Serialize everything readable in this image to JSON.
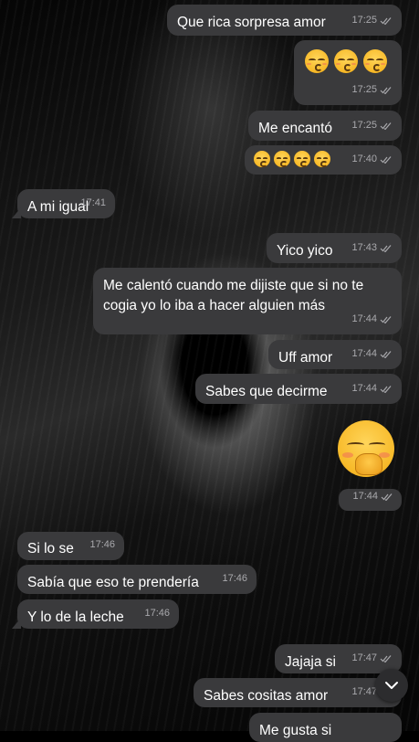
{
  "messages": [
    {
      "text": "Que rica sorpresa amor",
      "time": "17:25"
    },
    {
      "text": "",
      "time": "17:25"
    },
    {
      "text": "Me encantó",
      "time": "17:25"
    },
    {
      "text": "",
      "time": "17:40"
    },
    {
      "text": "A mi igual",
      "time": "17:41"
    },
    {
      "text": "Yico yico",
      "time": "17:43"
    },
    {
      "text": "Me calentó cuando me dijiste que si no te cogia yo lo iba a hacer alguien más",
      "time": "17:44"
    },
    {
      "text": "Uff amor",
      "time": "17:44"
    },
    {
      "text": "Sabes que decirme",
      "time": "17:44"
    },
    {
      "text": "",
      "time": "17:44"
    },
    {
      "text": "Si lo se",
      "time": "17:46"
    },
    {
      "text": "Sabía que eso te prendería",
      "time": "17:46"
    },
    {
      "text": "Y lo de la leche",
      "time": "17:46"
    },
    {
      "text": "Jajaja si",
      "time": "17:47"
    },
    {
      "text": "Sabes cositas amor",
      "time": "17:47"
    },
    {
      "text": "Me gusta si",
      "time": ""
    }
  ],
  "icons": {
    "read_receipt": "double-check-icon",
    "scroll_down": "chevron-down-icon",
    "emoji_kissing": "kissing-face-icon",
    "emoji_smirk": "smirking-face-icon",
    "emoji_hand_over_mouth": "hand-over-mouth-face-icon"
  },
  "colors": {
    "bubble": "#3a3a3c",
    "meta_text": "#a9a9ad",
    "emoji_yellow": "#f7b928"
  }
}
